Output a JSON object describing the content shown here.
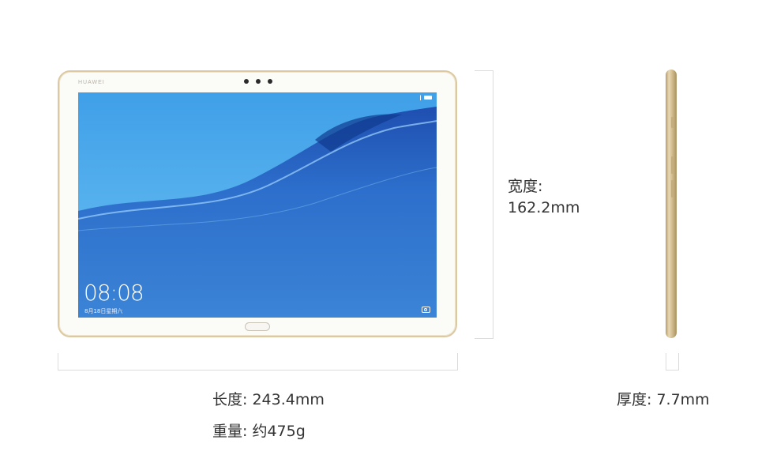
{
  "tablet": {
    "brand": "HUAWEI",
    "clock": "08:08",
    "date": "8月18日星期六"
  },
  "specs": {
    "width_label": "宽度:",
    "width_value": "162.2mm",
    "length": "长度: 243.4mm",
    "weight": "重量: 约475g",
    "thickness": "厚度: 7.7mm"
  },
  "colors": {
    "frame_gold": "#dcc9a2",
    "screen_blue": "#2f8ee0"
  }
}
